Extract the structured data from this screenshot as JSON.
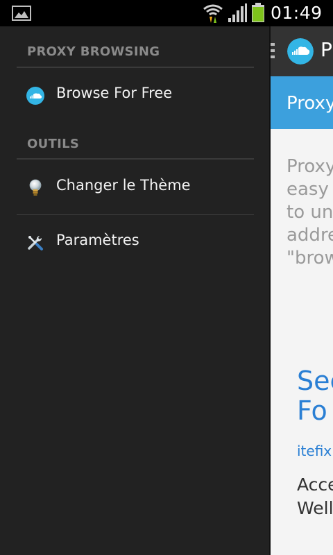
{
  "status_bar": {
    "time": "01:49",
    "icons": [
      "gallery-icon",
      "wifi-icon",
      "signal-icon",
      "battery-icon"
    ],
    "battery_color": "#7fc31c",
    "wifi_arrow_color": "#f0a818"
  },
  "drawer": {
    "sections": [
      {
        "header": "PROXY BROWSING",
        "items": [
          {
            "label": "Browse For Free",
            "icon": "cloud-icon"
          }
        ]
      },
      {
        "header": "OUTILS",
        "items": [
          {
            "label": "Changer le Thème",
            "icon": "lightbulb-icon"
          },
          {
            "label": "Paramètres",
            "icon": "tools-icon"
          }
        ]
      }
    ]
  },
  "content": {
    "actionbar_title": "P",
    "band_title": "Proxy",
    "intro_lines": [
      "Proxy",
      "easy",
      "to un",
      "addre",
      "\"brow"
    ],
    "link_title_lines": [
      "Sec",
      "Fo"
    ],
    "link_url": "itefix.",
    "description_lines": [
      "Acce",
      "Well"
    ]
  },
  "colors": {
    "drawer_bg": "#222222",
    "accent": "#3ca0dd",
    "brand_blue": "#33b5e5",
    "link": "#2a7fd4"
  }
}
